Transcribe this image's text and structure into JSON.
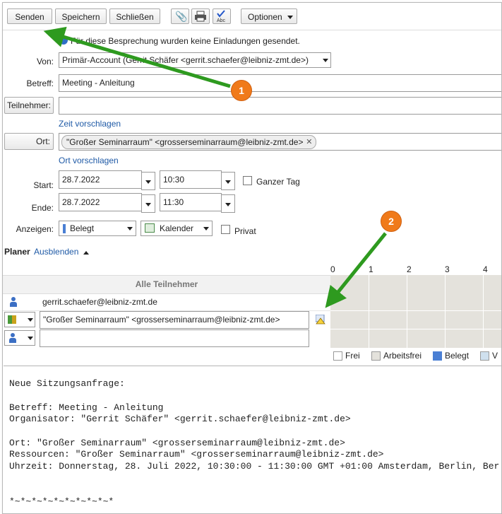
{
  "toolbar": {
    "send_label": "Senden",
    "save_label": "Speichern",
    "close_label": "Schließen",
    "options_label": "Optionen"
  },
  "notice": "Für diese Besprechung wurden keine Einladungen gesendet.",
  "form": {
    "from_label": "Von:",
    "from_value": "Primär-Account (Gerrit Schäfer <gerrit.schaefer@leibniz-zmt.de>)",
    "subject_label": "Betreff:",
    "subject_value": "Meeting - Anleitung",
    "attendees_label": "Teilnehmer:",
    "suggest_time": "Zeit vorschlagen",
    "location_label": "Ort:",
    "location_chip": "\"Großer Seminarraum\" <grosserseminarraum@leibniz-zmt.de>",
    "suggest_location": "Ort vorschlagen",
    "start_label": "Start:",
    "start_date": "28.7.2022",
    "start_time": "10:30",
    "allday_label": "Ganzer Tag",
    "end_label": "Ende:",
    "end_date": "28.7.2022",
    "end_time": "11:30",
    "show_label": "Anzeigen:",
    "show_value": "Belegt",
    "calendar_value": "Kalender",
    "private_label": "Privat"
  },
  "planner": {
    "title": "Planer",
    "hide_link": "Ausblenden",
    "hours": [
      "0",
      "1",
      "2",
      "3",
      "4"
    ],
    "all_attendees": "Alle Teilnehmer",
    "rows": [
      "gerrit.schaefer@leibniz-zmt.de",
      "\"Großer Seminarraum\" <grosserseminarraum@leibniz-zmt.de>",
      ""
    ],
    "legend": [
      "Frei",
      "Arbeitsfrei",
      "Belegt",
      "V"
    ]
  },
  "body_text": [
    "Neue Sitzungsanfrage:",
    "",
    "Betreff: Meeting - Anleitung",
    "Organisator: \"Gerrit Schäfer\" <gerrit.schaefer@leibniz-zmt.de>",
    "",
    "Ort: \"Großer Seminarraum\" <grosserseminarraum@leibniz-zmt.de>",
    "Ressourcen: \"Großer Seminarraum\" <grosserseminarraum@leibniz-zmt.de>",
    "Uhrzeit: Donnerstag, 28. Juli 2022, 10:30:00 - 11:30:00 GMT +01:00 Amsterdam, Berlin, Ber",
    "",
    "",
    "*~*~*~*~*~*~*~*~*~*"
  ],
  "callouts": [
    "1",
    "2"
  ],
  "colors": {
    "accent_link": "#1f5aa6",
    "callout_orange": "#f07a1a",
    "arrow_green": "#2e9a1f",
    "busy_blue": "#4a7fd4",
    "grid_bg": "#e4e2dc"
  }
}
